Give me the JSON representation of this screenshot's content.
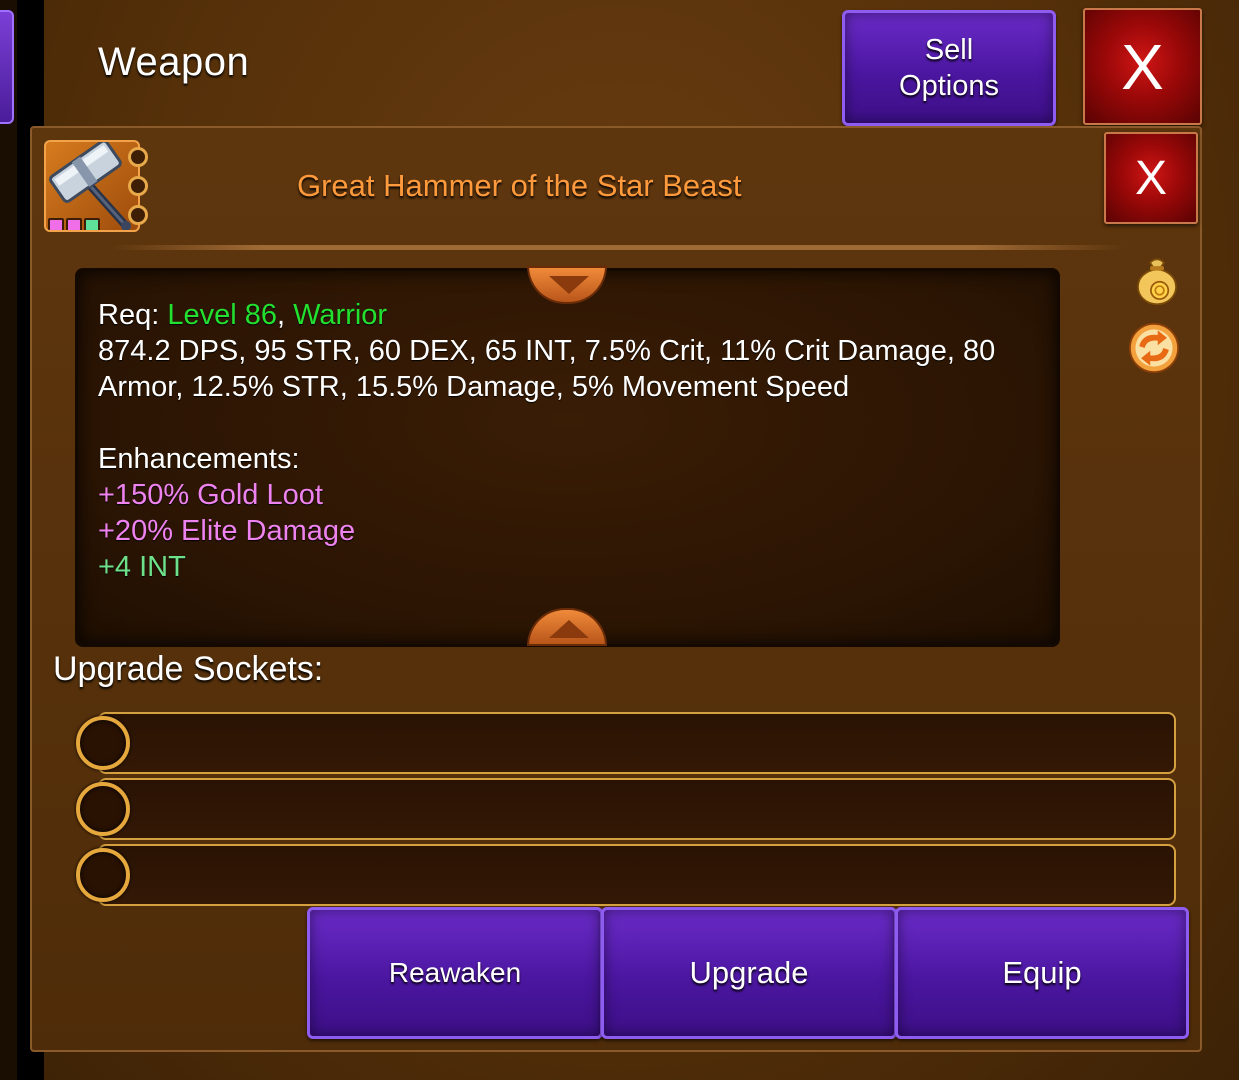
{
  "header": {
    "title": "Weapon",
    "sell_line1": "Sell",
    "sell_line2": "Options",
    "close_label": "X"
  },
  "item": {
    "name": "Great Hammer of the Star Beast",
    "close_label": "X",
    "name_color": "#ff9a3c",
    "requirement": {
      "prefix": "Req: ",
      "level": "Level 86",
      "separator": ", ",
      "class": "Warrior"
    },
    "stats": "874.2 DPS, 95 STR, 60 DEX, 65 INT, 7.5% Crit, 11% Crit Damage, 80 Armor, 12.5% STR, 15.5% Damage, 5% Movement Speed",
    "enhancements_label": "Enhancements:",
    "enhancements": [
      {
        "text": "+150% Gold Loot",
        "color": "#ee82ee"
      },
      {
        "text": "+20% Elite Damage",
        "color": "#ee82ee"
      },
      {
        "text": "+4 INT",
        "color": "#6fe08a"
      }
    ],
    "gem_colors": [
      "#f06ee8",
      "#f06ee8",
      "#5fe09a"
    ]
  },
  "sockets": {
    "label": "Upgrade Sockets:",
    "count": 3
  },
  "actions": {
    "reawaken": "Reawaken",
    "upgrade": "Upgrade",
    "equip": "Equip"
  },
  "icons": {
    "sell_bag": "gold-bag-icon",
    "cycle": "cycle-arrows-icon"
  }
}
